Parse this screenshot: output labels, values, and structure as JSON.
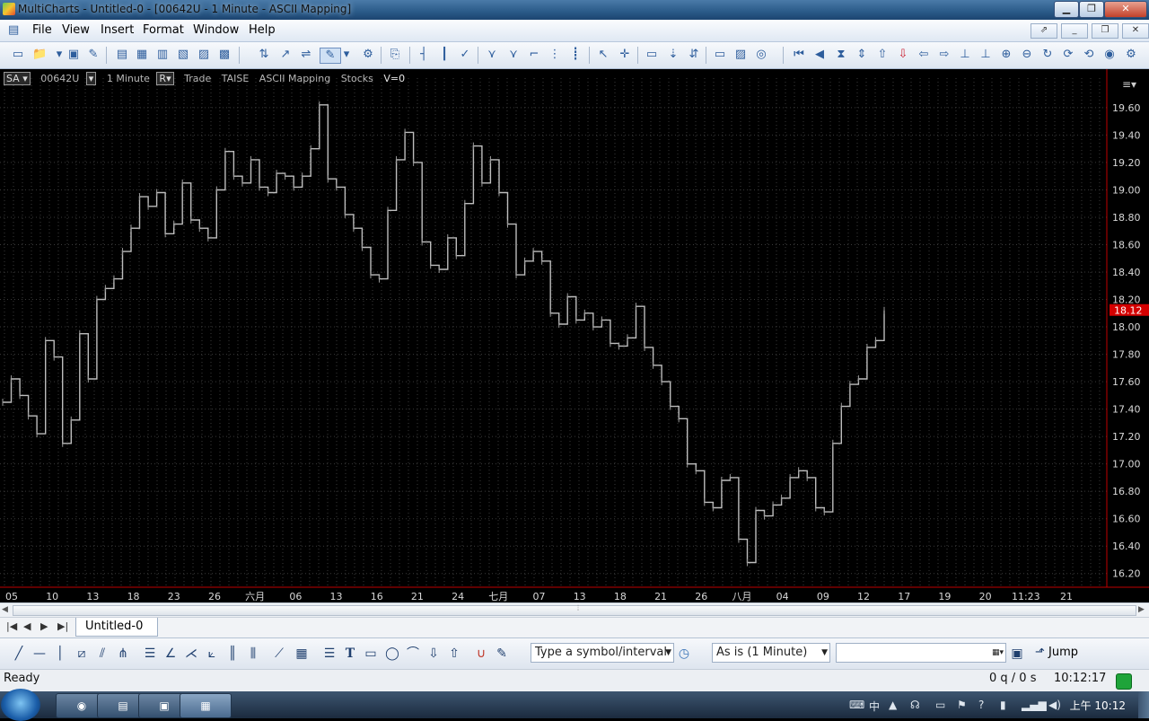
{
  "window": {
    "title": "MultiCharts - Untitled-0 - [00642U - 1 Minute - ASCII Mapping]",
    "buttons": [
      "minimize",
      "restore",
      "close"
    ]
  },
  "menu": {
    "items": [
      "File",
      "View",
      "Insert",
      "Format",
      "Window",
      "Help"
    ]
  },
  "chart_header": {
    "style_label": "SA",
    "symbol": "00642U",
    "interval": "1 Minute",
    "range_label": "R",
    "data_type": "Trade",
    "exchange": "TAISE",
    "data_source": "ASCII Mapping",
    "category": "Stocks",
    "volume_text": "V=0"
  },
  "chart_data": {
    "type": "line",
    "title": "",
    "xlabel": "",
    "ylabel": "",
    "ylim": [
      16.1,
      19.75
    ],
    "y_ticks": [
      "19.60",
      "19.40",
      "19.20",
      "19.00",
      "18.80",
      "18.60",
      "18.40",
      "18.20",
      "18.00",
      "17.80",
      "17.60",
      "17.40",
      "17.20",
      "17.00",
      "16.80",
      "16.60",
      "16.40",
      "16.20"
    ],
    "x_ticks": [
      "05",
      "10",
      "13",
      "18",
      "23",
      "26",
      "六月",
      "06",
      "13",
      "16",
      "21",
      "24",
      "七月",
      "07",
      "13",
      "18",
      "21",
      "26",
      "八月",
      "04",
      "09",
      "12",
      "17",
      "19",
      "20",
      "11:23",
      "21"
    ],
    "last_price_label": "18.12",
    "grid": true,
    "series": [
      {
        "values": [
          17.45,
          17.62,
          17.5,
          17.35,
          17.22,
          17.9,
          17.78,
          17.15,
          17.32,
          17.95,
          17.62,
          18.2,
          18.28,
          18.35,
          18.55,
          18.72,
          18.95,
          18.88,
          18.98,
          18.68,
          18.75,
          19.05,
          18.78,
          18.72,
          18.65,
          19.0,
          19.28,
          19.1,
          19.05,
          19.22,
          19.02,
          18.98,
          19.12,
          19.1,
          19.02,
          19.1,
          19.3,
          19.62,
          19.08,
          19.02,
          18.82,
          18.72,
          18.58,
          18.38,
          18.35,
          18.85,
          19.22,
          19.42,
          19.2,
          18.62,
          18.45,
          18.42,
          18.65,
          18.52,
          18.9,
          19.32,
          19.05,
          19.22,
          18.98,
          18.75,
          18.38,
          18.48,
          18.55,
          18.48,
          18.1,
          18.02,
          18.22,
          18.05,
          18.1,
          18.0,
          18.05,
          17.88,
          17.86,
          17.92,
          18.15,
          17.85,
          17.72,
          17.6,
          17.42,
          17.33,
          17.0,
          16.95,
          16.72,
          16.68,
          16.88,
          16.9,
          16.45,
          16.28,
          16.66,
          16.62,
          16.7,
          16.75,
          16.9,
          16.95,
          16.9,
          16.68,
          16.65,
          17.15,
          17.42,
          17.58,
          17.62,
          17.85,
          17.9,
          18.12
        ]
      }
    ]
  },
  "tabs": {
    "nav": [
      "first",
      "previous",
      "next",
      "last"
    ],
    "items": [
      "Untitled-0"
    ]
  },
  "drawbar": {
    "symbol_placeholder": "Type a symbol/interval",
    "resolution": "As is (1 Minute)",
    "jump_label": "Jump"
  },
  "statusbar": {
    "status": "Ready",
    "quotes": "0 q / 0 s",
    "time": "10:12:17"
  },
  "taskbar": {
    "clock": "上午 10:12"
  }
}
